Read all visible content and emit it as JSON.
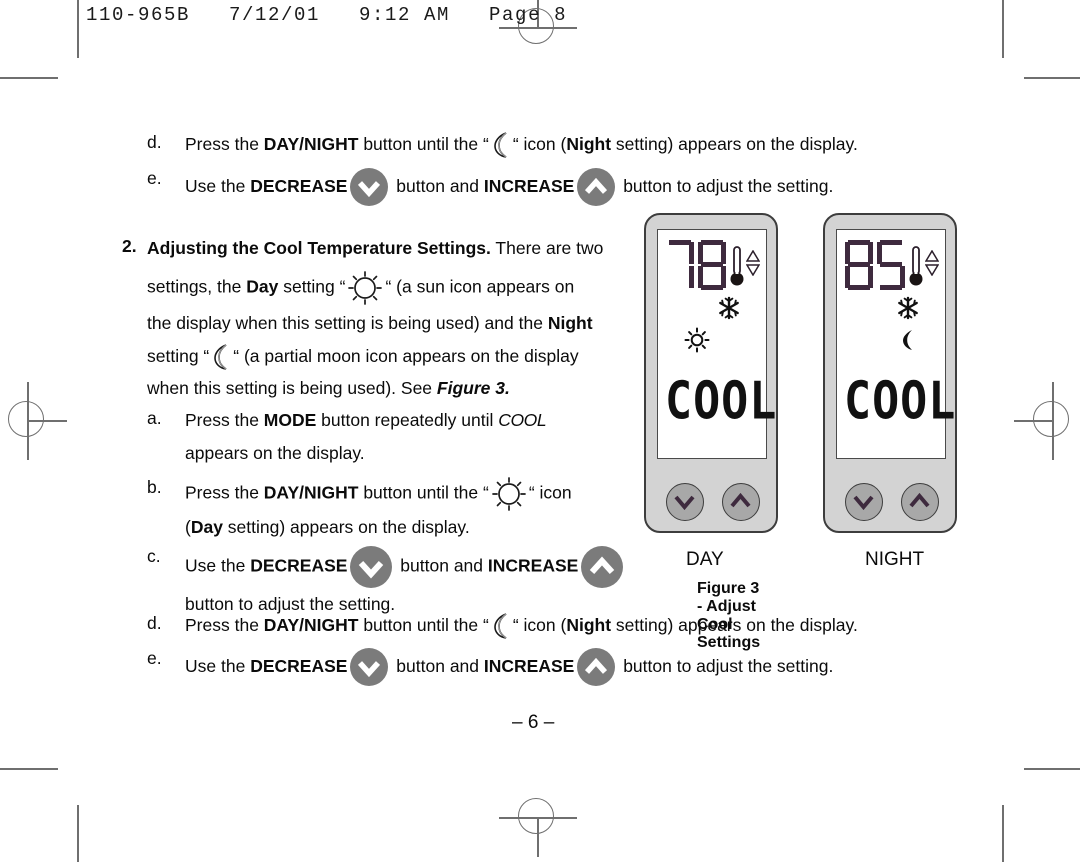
{
  "header": {
    "slug": "110-965B   7/12/01   9:12 AM   Page 8"
  },
  "instructions_top": [
    {
      "marker": "d.",
      "segments_label": "Press the DAY/NIGHT button until the “ (moon icon) “ icon (Night setting) appears on the display.",
      "pre": "Press the ",
      "bold1": "DAY/NIGHT",
      "mid1": " button until the “",
      "icon": "moon-icon",
      "mid2": "“ icon (",
      "bold2": "Night",
      "post": " setting) appears on the display."
    },
    {
      "marker": "e.",
      "pre": "Use the ",
      "bold1": "DECREASE",
      "icon1": "decrease-chevron-down-icon",
      "mid1": " button and ",
      "bold2": "INCREASE",
      "icon2": "increase-chevron-up-icon",
      "post": " button to adjust the setting."
    }
  ],
  "section2": {
    "marker": "2.",
    "title": "Adjusting the Cool Temperature Settings.",
    "line1_rest": " There are two",
    "line2_a": "settings, the ",
    "line2_bold": "Day",
    "line2_b": " setting “",
    "line2_c": "“ (a sun icon appears on",
    "line3": "the display when this setting is being used) and the ",
    "line3_bold": "Night",
    "line4_a": "setting “",
    "line4_b": "“ (a partial moon icon appears on the display",
    "line5_a": "when this setting is being used). See ",
    "line5_figref": "Figure 3."
  },
  "instructions_mid": [
    {
      "marker": "a.",
      "pre": "Press the ",
      "bold1": "MODE",
      "mid1": " button repeatedly until ",
      "cool": "COOL",
      "line2": "appears on the display."
    },
    {
      "marker": "b.",
      "pre": "Press the ",
      "bold1": "DAY/NIGHT",
      "mid1": " button until the “",
      "icon": "sun-icon",
      "mid2": "“ icon",
      "line2_a": "(",
      "line2_bold": "Day",
      "line2_b": " setting) appears on the display."
    },
    {
      "marker": "c.",
      "pre": "Use the ",
      "bold1": "DECREASE",
      "icon1": "decrease-chevron-down-icon",
      "mid1": " button and ",
      "bold2": "INCREASE",
      "icon2": "increase-chevron-up-icon",
      "line2": "button to adjust the setting."
    }
  ],
  "instructions_bottom": [
    {
      "marker": "d.",
      "pre": "Press the ",
      "bold1": "DAY/NIGHT",
      "mid1": " button until the “",
      "icon": "moon-icon",
      "mid2": "“ icon (",
      "bold2": "Night",
      "post": " setting) appears on the display."
    },
    {
      "marker": "e.",
      "pre": "Use the ",
      "bold1": "DECREASE",
      "icon1": "decrease-chevron-down-icon",
      "mid1": " button and ",
      "bold2": "INCREASE",
      "icon2": "increase-chevron-up-icon",
      "post": " button to adjust the setting."
    }
  ],
  "figure": {
    "day_device": {
      "temperature": "78",
      "mode_word": "COOL",
      "icons": [
        "thermometer-icon",
        "up-down-arrows-icon",
        "snowflake-icon",
        "sun-icon"
      ],
      "buttons": [
        "decrease-chevron-down-icon",
        "increase-chevron-up-icon"
      ]
    },
    "night_device": {
      "temperature": "85",
      "mode_word": "COOL",
      "icons": [
        "thermometer-icon",
        "up-down-arrows-icon",
        "snowflake-icon",
        "moon-icon"
      ],
      "buttons": [
        "decrease-chevron-down-icon",
        "increase-chevron-up-icon"
      ]
    },
    "label_day": "DAY",
    "label_night": "NIGHT",
    "caption": "Figure 3 - Adjust Cool Settings"
  },
  "footer": {
    "page_number": "– 6 –"
  },
  "colors": {
    "lcd_segment": "#3e2a3e",
    "device_body": "#d3d3d3",
    "device_button": "#a8a8a8",
    "inline_button": "#7b7b7b",
    "crop_mark": "#6f6f6f"
  }
}
